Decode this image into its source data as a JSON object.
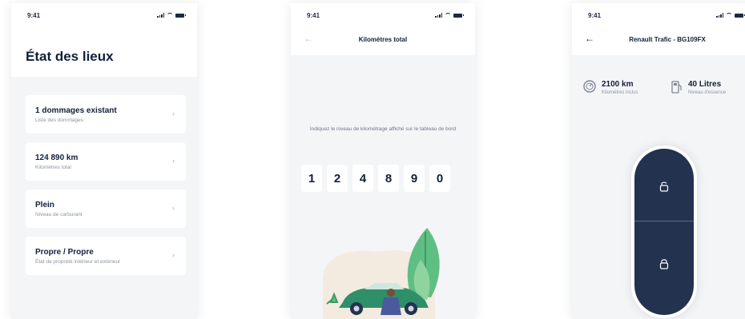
{
  "screens": {
    "etat": {
      "time": "9:41",
      "title": "État des lieux",
      "items": [
        {
          "title": "1 dommages existant",
          "subtitle": "Liste des dommages"
        },
        {
          "title": "124 890 km",
          "subtitle": "Kilomètres total"
        },
        {
          "title": "Plein",
          "subtitle": "Niveau de carburant"
        },
        {
          "title": "Propre / Propre",
          "subtitle": "État de propreté intérieur et extérieur"
        }
      ]
    },
    "km": {
      "time": "9:41",
      "title": "Kilomètres total",
      "instruction": "Indiquez le niveau de kilométrage affiché sur le tableau de bord",
      "digits": [
        "1",
        "2",
        "4",
        "8",
        "9",
        "0"
      ]
    },
    "vehicle": {
      "time": "9:41",
      "title": "Renault Trafic - BG109FX",
      "mileage": {
        "value": "2100 km",
        "label": "Kilomètres inclus"
      },
      "fuel": {
        "value": "40 Litres",
        "label": "Niveau d'essence"
      }
    }
  },
  "icons": {
    "chevron": "›",
    "back": "←"
  },
  "colors": {
    "navy": "#22324f",
    "text": "#12203a",
    "background": "#f4f5f7",
    "car_green": "#2f8f68"
  }
}
